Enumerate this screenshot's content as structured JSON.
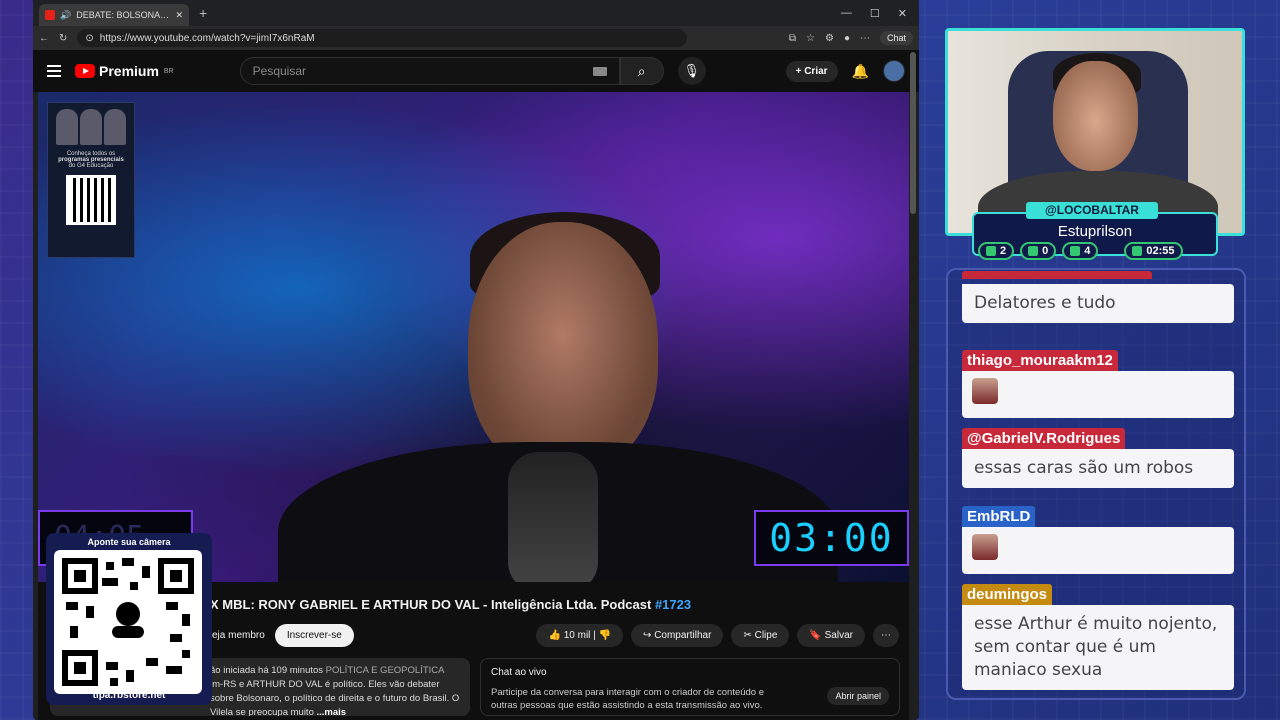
{
  "browser": {
    "tab_title": "DEBATE: BOLSONARISTA X M",
    "url": "https://www.youtube.com/watch?v=jimI7x6nRaM",
    "chat_button": "Chat"
  },
  "youtube": {
    "logo_text": "Premium",
    "logo_region": "BR",
    "search_placeholder": "Pesquisar",
    "create_label": "Criar",
    "video_title_main": "X MBL: RONY GABRIEL E ARTHUR DO VAL - Inteligência Ltda. Podcast ",
    "video_title_hash": "#1723",
    "member_label": "eja membro",
    "subscribe_label": "Inscrever-se",
    "like_count": "10 mil",
    "share_label": "Compartilhar",
    "clip_label": "Clipe",
    "save_label": "Salvar",
    "description_meta": "ão iniciada há 109 minutos",
    "description_tags": "POLÍTICA E GEOPOLÍTICA",
    "description_line2": "im-RS e ARTHUR DO VAL é político. Eles vão debater",
    "description_line3": "sobre Bolsonaro, o político de direita e o futuro do Brasil. O Vilela se preocupa muito",
    "description_more": "...mais",
    "live_chat_title": "Chat ao vivo",
    "live_chat_text": "Participe da conversa para interagir com o criador de conteúdo e outras pessoas que estão assistindo a esta transmissão ao vivo.",
    "open_panel_label": "Abrir painel",
    "timer_left": "04:05",
    "timer_right": "03:00",
    "ad_text_1": "Conheça todos os",
    "ad_text_2": "programas presenciais",
    "ad_text_3": "do G4 Educação"
  },
  "qr_overlay": {
    "title": "Aponte sua câmera",
    "url": "tipa.rbstore.net"
  },
  "streamer": {
    "handle": "@LOCOBALTAR",
    "name": "Estuprilson",
    "stat_chat": "2",
    "stat_video": "0",
    "stat_members": "4",
    "stat_time": "02:55"
  },
  "chat": {
    "messages": [
      {
        "author": "",
        "body": "Delatores e tudo",
        "color": "#c7283a"
      },
      {
        "author": "thiago_mouraakm12",
        "body": "",
        "color": "#c7283a"
      },
      {
        "author": "@GabrielV.Rodrigues",
        "body": "essas caras são um robos",
        "color": "#c7283a"
      },
      {
        "author": "EmbRLD",
        "body": "",
        "color": "#2a63c7"
      },
      {
        "author": "deumingos",
        "body": "esse Arthur é muito nojento, sem contar que é um maniaco sexua",
        "color": "#c58a10"
      }
    ]
  }
}
